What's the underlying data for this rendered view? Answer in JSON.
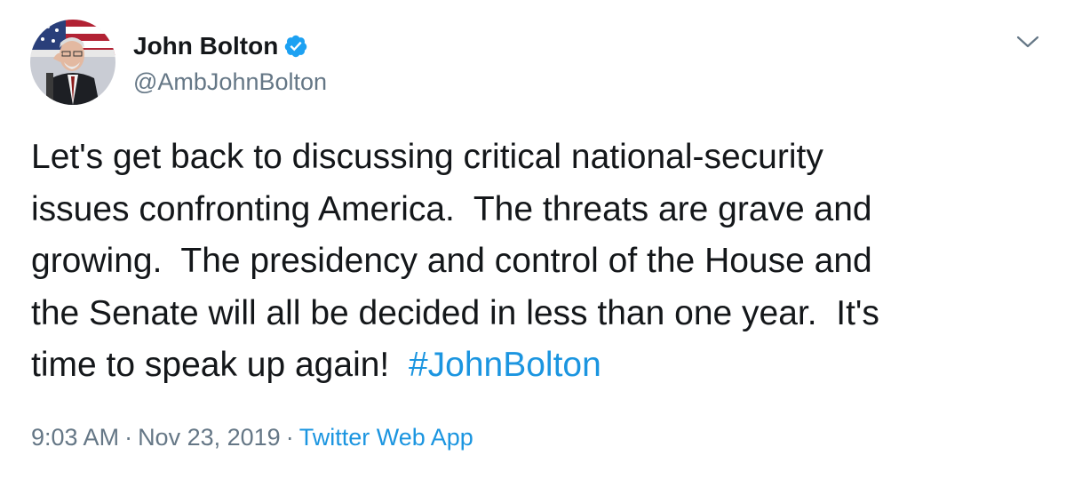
{
  "author": {
    "name": "John Bolton",
    "handle": "@AmbJohnBolton",
    "verified": true
  },
  "icons": {
    "verified": "verified-badge-icon",
    "menu": "chevron-down-icon"
  },
  "tweet": {
    "line1": "Let's get back to discussing critical national-security",
    "line2": "issues confronting America.  The threats are grave and",
    "line3": "growing.  The presidency and control of the House and",
    "line4": "the Senate will all be decided in less than one year.  It's",
    "line5_text": "time to speak up again!  ",
    "hashtag": "#JohnBolton"
  },
  "meta": {
    "time": "9:03 AM",
    "separator": "·",
    "date": "Nov 23, 2019",
    "source": "Twitter Web App"
  },
  "colors": {
    "link": "#1b95e0",
    "secondary_text": "#657786",
    "primary_text": "#14171a"
  }
}
